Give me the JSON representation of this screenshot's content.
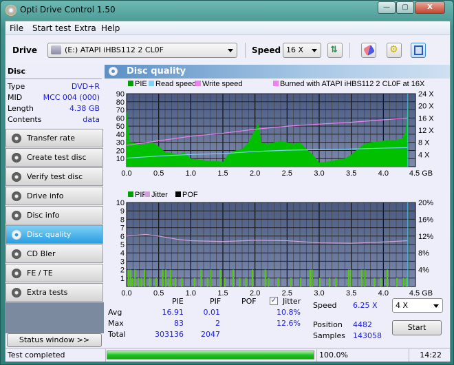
{
  "window": {
    "title": "Opti Drive Control 1.50",
    "minimize": "—",
    "maximize": "▢",
    "close": "X"
  },
  "menu": [
    "File",
    "Start test",
    "Extra",
    "Help"
  ],
  "toolbar": {
    "drive_label": "Drive",
    "drive_value": "(E:)   ATAPI iHBS112   2 CL0F",
    "speed_label": "Speed",
    "speed_value": "16 X",
    "buttons": [
      "refresh-icon",
      "eraser-icon",
      "settings-icon",
      "save-icon"
    ]
  },
  "disc": {
    "heading": "Disc",
    "rows": [
      {
        "key": "Type",
        "value": "DVD+R"
      },
      {
        "key": "MID",
        "value": "MCC 004 (000)"
      },
      {
        "key": "Length",
        "value": "4.38 GB"
      },
      {
        "key": "Contents",
        "value": "data"
      }
    ]
  },
  "nav": [
    {
      "label": "Transfer rate",
      "active": false
    },
    {
      "label": "Create test disc",
      "active": false
    },
    {
      "label": "Verify test disc",
      "active": false
    },
    {
      "label": "Drive info",
      "active": false
    },
    {
      "label": "Disc info",
      "active": false
    },
    {
      "label": "Disc quality",
      "active": true
    },
    {
      "label": "CD Bler",
      "active": false
    },
    {
      "label": "FE / TE",
      "active": false
    },
    {
      "label": "Extra tests",
      "active": false
    }
  ],
  "status_window_label": "Status window >>",
  "panel": {
    "title": "Disc quality"
  },
  "chart_data": [
    {
      "type": "area",
      "title": "",
      "legend": [
        "PIE",
        "Read speed",
        "Write speed",
        "Burned with ATAPI iHBS112   2 CL0F at 16X"
      ],
      "legend_colors": [
        "#00a000",
        "#80d0f8",
        "#f080f0",
        "#f080f0"
      ],
      "xlabel": "GB",
      "x_ticks": [
        "0.0",
        "0.5",
        "1.0",
        "1.5",
        "2.0",
        "2.5",
        "3.0",
        "3.5",
        "4.0",
        "4.5 GB"
      ],
      "y_left_ticks": [
        "10",
        "20",
        "30",
        "40",
        "50",
        "60",
        "70",
        "80",
        "90"
      ],
      "y_right_ticks": [
        "4 X",
        "8 X",
        "12 X",
        "16 X",
        "20 X",
        "24 X"
      ],
      "xlim": [
        0,
        4.5
      ],
      "ylim_left": [
        0,
        90
      ],
      "ylim_right": [
        0,
        24
      ],
      "series": [
        {
          "name": "PIE",
          "x": [
            0.0,
            0.02,
            0.05,
            0.1,
            0.2,
            0.3,
            0.4,
            0.5,
            0.6,
            0.7,
            0.8,
            0.9,
            1.0,
            1.1,
            1.2,
            1.3,
            1.4,
            1.5,
            1.6,
            1.7,
            1.8,
            1.9,
            2.0,
            2.05,
            2.1,
            2.2,
            2.3,
            2.4,
            2.5,
            2.6,
            2.7,
            2.8,
            2.9,
            2.95,
            3.0,
            3.1,
            3.2,
            3.3,
            3.4,
            3.5,
            3.6,
            3.7,
            3.8,
            3.9,
            4.0,
            4.1,
            4.2,
            4.3,
            4.35,
            4.38
          ],
          "values": [
            70,
            55,
            30,
            30,
            27,
            28,
            30,
            25,
            18,
            17,
            15,
            18,
            10,
            9,
            8,
            7,
            7,
            6,
            17,
            20,
            22,
            30,
            45,
            55,
            30,
            28,
            30,
            32,
            30,
            28,
            30,
            22,
            15,
            10,
            5,
            6,
            7,
            9,
            10,
            15,
            22,
            28,
            30,
            31,
            32,
            33,
            33,
            35,
            45,
            80
          ]
        },
        {
          "name": "Read speed",
          "unit": "X",
          "x": [
            0.0,
            0.5,
            1.0,
            1.5,
            2.0,
            2.5,
            3.0,
            3.5,
            4.0,
            4.38
          ],
          "values": [
            2.8,
            3.5,
            4.0,
            4.3,
            5.0,
            5.4,
            5.6,
            5.8,
            6.1,
            6.25
          ]
        },
        {
          "name": "Write speed",
          "unit": "X",
          "x": [
            0.0,
            0.5,
            1.0,
            1.5,
            2.0,
            2.5,
            3.0,
            3.5,
            4.0,
            4.38
          ],
          "values": [
            7.0,
            8.5,
            10.0,
            11.0,
            12.3,
            13.3,
            14.0,
            14.6,
            15.4,
            16.0
          ]
        }
      ]
    },
    {
      "type": "bar",
      "legend": [
        "PIF",
        "Jitter",
        "POF"
      ],
      "legend_colors": [
        "#00a000",
        "#d0a0d8",
        "#000000"
      ],
      "xlabel": "GB",
      "x_ticks": [
        "0.0",
        "0.5",
        "1.0",
        "1.5",
        "2.0",
        "2.5",
        "3.0",
        "3.5",
        "4.0",
        "4.5 GB"
      ],
      "y_left_ticks": [
        "1",
        "2",
        "3",
        "4",
        "5",
        "6",
        "7",
        "8",
        "9",
        "10"
      ],
      "y_right_ticks": [
        "4%",
        "8%",
        "12%",
        "16%",
        "20%"
      ],
      "xlim": [
        0,
        4.5
      ],
      "ylim_left": [
        0,
        10
      ],
      "ylim_right": [
        0,
        20
      ],
      "series": [
        {
          "name": "Jitter",
          "unit": "%",
          "x": [
            0.0,
            0.3,
            0.5,
            0.8,
            1.0,
            1.5,
            2.0,
            2.5,
            3.0,
            3.5,
            4.0,
            4.38
          ],
          "values": [
            12.0,
            12.4,
            12.0,
            11.2,
            10.9,
            10.7,
            11.0,
            10.9,
            10.4,
            10.3,
            10.6,
            10.9
          ]
        },
        {
          "name": "PIF",
          "x": [
            0.02,
            0.05,
            0.08,
            0.12,
            0.18,
            0.22,
            0.27,
            0.35,
            0.45,
            0.55,
            0.6,
            0.65,
            0.68,
            0.75,
            0.85,
            1.05,
            1.15,
            1.25,
            1.3,
            1.45,
            1.52,
            1.65,
            1.75,
            1.85,
            1.95,
            2.15,
            2.2,
            2.35,
            2.55,
            2.7,
            2.85,
            2.88,
            3.0,
            3.15,
            3.25,
            3.45,
            3.48,
            3.65,
            3.7,
            3.85,
            3.95,
            4.05,
            4.2,
            4.3,
            4.35
          ],
          "values": [
            2,
            2,
            1,
            2,
            1,
            1,
            2,
            1,
            1,
            2,
            2,
            1,
            2,
            1,
            1,
            1,
            2,
            1,
            2,
            2,
            1,
            2,
            1,
            1,
            2,
            2,
            1,
            1,
            1,
            1,
            2,
            2,
            1,
            1,
            1,
            2,
            2,
            2,
            2,
            1,
            1,
            2,
            1,
            1,
            1
          ]
        }
      ]
    }
  ],
  "stats": {
    "headers": [
      "PIE",
      "PIF",
      "POF",
      "Jitter"
    ],
    "jitter_checked": true,
    "rows": [
      {
        "label": "Avg",
        "pie": "16.91",
        "pif": "0.01",
        "pof": "",
        "jitter": "10.8%"
      },
      {
        "label": "Max",
        "pie": "83",
        "pif": "2",
        "pof": "",
        "jitter": "12.6%"
      },
      {
        "label": "Total",
        "pie": "303136",
        "pif": "2047",
        "pof": "",
        "jitter": ""
      }
    ],
    "speed_label": "Speed",
    "speed_value": "6.25 X",
    "speed_select": "4 X",
    "position_label": "Position",
    "position_value": "4482",
    "samples_label": "Samples",
    "samples_value": "143058",
    "start_label": "Start"
  },
  "statusbar": {
    "message": "Test completed",
    "progress": 100.0,
    "progress_text": "100.0%",
    "time": "14:22"
  }
}
